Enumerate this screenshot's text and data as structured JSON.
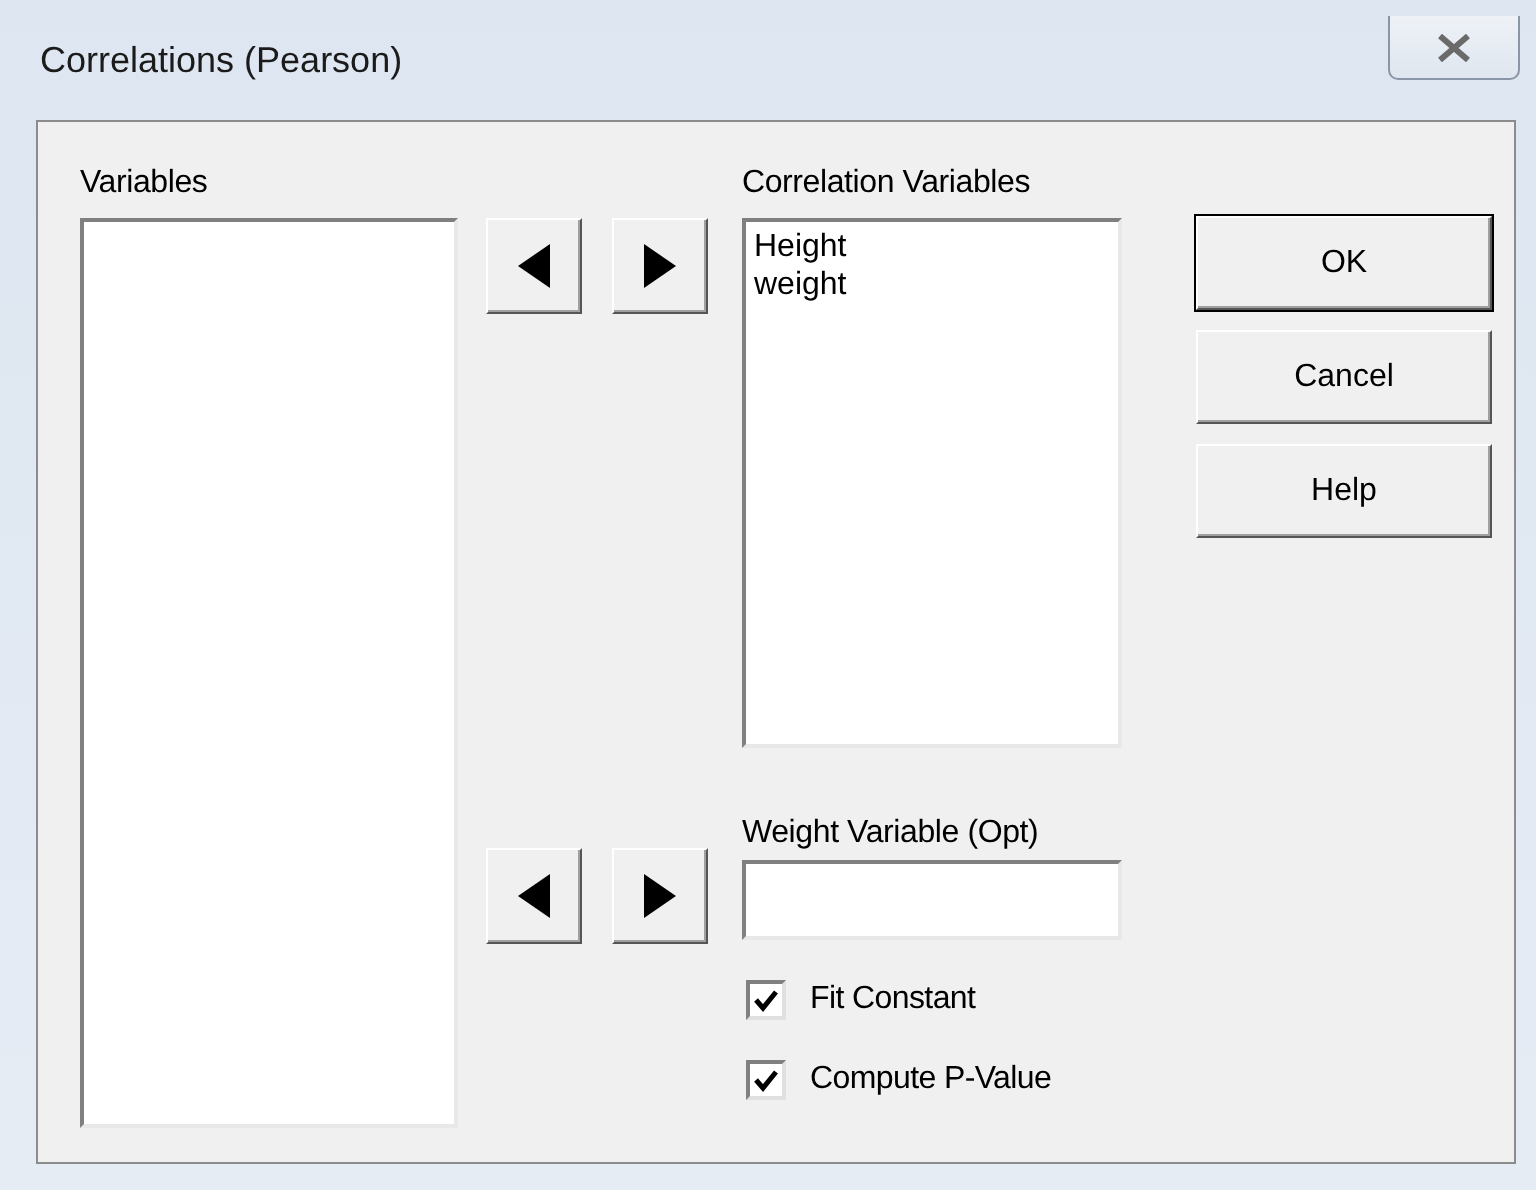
{
  "window": {
    "title": "Correlations (Pearson)"
  },
  "variables": {
    "label": "Variables"
  },
  "correlation_variables": {
    "label": "Correlation Variables",
    "items": [
      "Height",
      "weight"
    ]
  },
  "weight_variable": {
    "label": "Weight Variable (Opt)"
  },
  "options": [
    {
      "label": "Fit Constant",
      "checked": true
    },
    {
      "label": "Compute P-Value",
      "checked": true
    }
  ],
  "buttons": [
    {
      "label": "OK",
      "default": true
    },
    {
      "label": "Cancel",
      "default": false
    },
    {
      "label": "Help",
      "default": false
    }
  ]
}
